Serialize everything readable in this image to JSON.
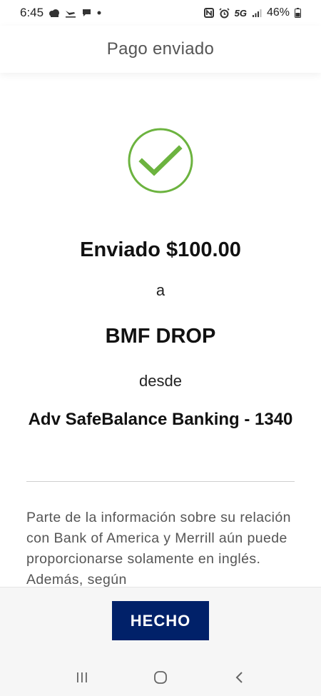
{
  "status_bar": {
    "time": "6:45",
    "network": "5G",
    "battery": "46%"
  },
  "header": {
    "title": "Pago enviado"
  },
  "confirmation": {
    "sent_line": "Enviado $100.00",
    "to_word": "a",
    "recipient": "BMF DROP",
    "from_word": "desde",
    "account": "Adv SafeBalance Banking - 1340",
    "check_color": "#6cb33f"
  },
  "disclaimer": {
    "text": "Parte de la información sobre su relación con Bank of America y Merrill aún puede proporcionarse solamente en inglés. Además, según"
  },
  "footer": {
    "done_label": "HECHO",
    "done_color": "#012169"
  },
  "nav_bar": {
    "icons": [
      "recent-apps-icon",
      "home-icon",
      "back-icon"
    ]
  }
}
